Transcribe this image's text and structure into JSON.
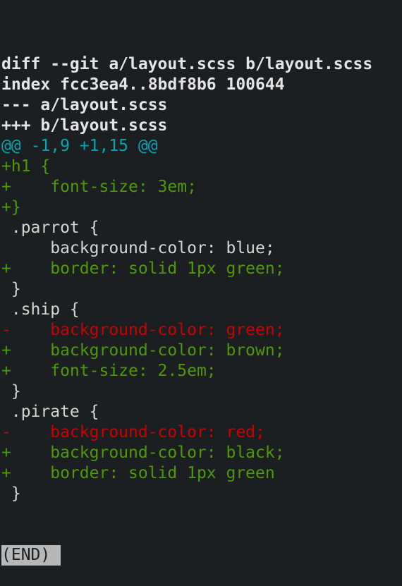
{
  "terminal": {
    "lines": [
      {
        "type": "header",
        "text": "diff --git a/layout.scss b/layout.scss"
      },
      {
        "type": "header",
        "text": "index fcc3ea4..8bdf8b6 100644"
      },
      {
        "type": "header",
        "text": "--- a/layout.scss"
      },
      {
        "type": "header",
        "text": "+++ b/layout.scss"
      },
      {
        "type": "hunk",
        "text": "@@ -1,9 +1,15 @@"
      },
      {
        "type": "add",
        "text": "+h1 {"
      },
      {
        "type": "add",
        "text": "+    font-size: 3em;"
      },
      {
        "type": "add",
        "text": "+}"
      },
      {
        "type": "ctx",
        "text": " .parrot {"
      },
      {
        "type": "ctx",
        "text": "     background-color: blue;"
      },
      {
        "type": "add",
        "text": "+    border: solid 1px green;"
      },
      {
        "type": "ctx",
        "text": " }"
      },
      {
        "type": "ctx",
        "text": " .ship {"
      },
      {
        "type": "del",
        "text": "-    background-color: green;"
      },
      {
        "type": "add",
        "text": "+    background-color: brown;"
      },
      {
        "type": "add",
        "text": "+    font-size: 2.5em;"
      },
      {
        "type": "ctx",
        "text": " }"
      },
      {
        "type": "ctx",
        "text": " .pirate {"
      },
      {
        "type": "del",
        "text": "-    background-color: red;"
      },
      {
        "type": "add",
        "text": "+    background-color: black;"
      },
      {
        "type": "add",
        "text": "+    border: solid 1px green"
      },
      {
        "type": "ctx",
        "text": " }"
      }
    ],
    "pager_status": "(END)"
  },
  "colors": {
    "background": "#1c1f22",
    "header": "#e4e4e4",
    "hunk": "#06a5b3",
    "added": "#4e9a06",
    "removed": "#cc0000",
    "context": "#d3d7cf",
    "pager_bg": "#b7b7b7"
  }
}
